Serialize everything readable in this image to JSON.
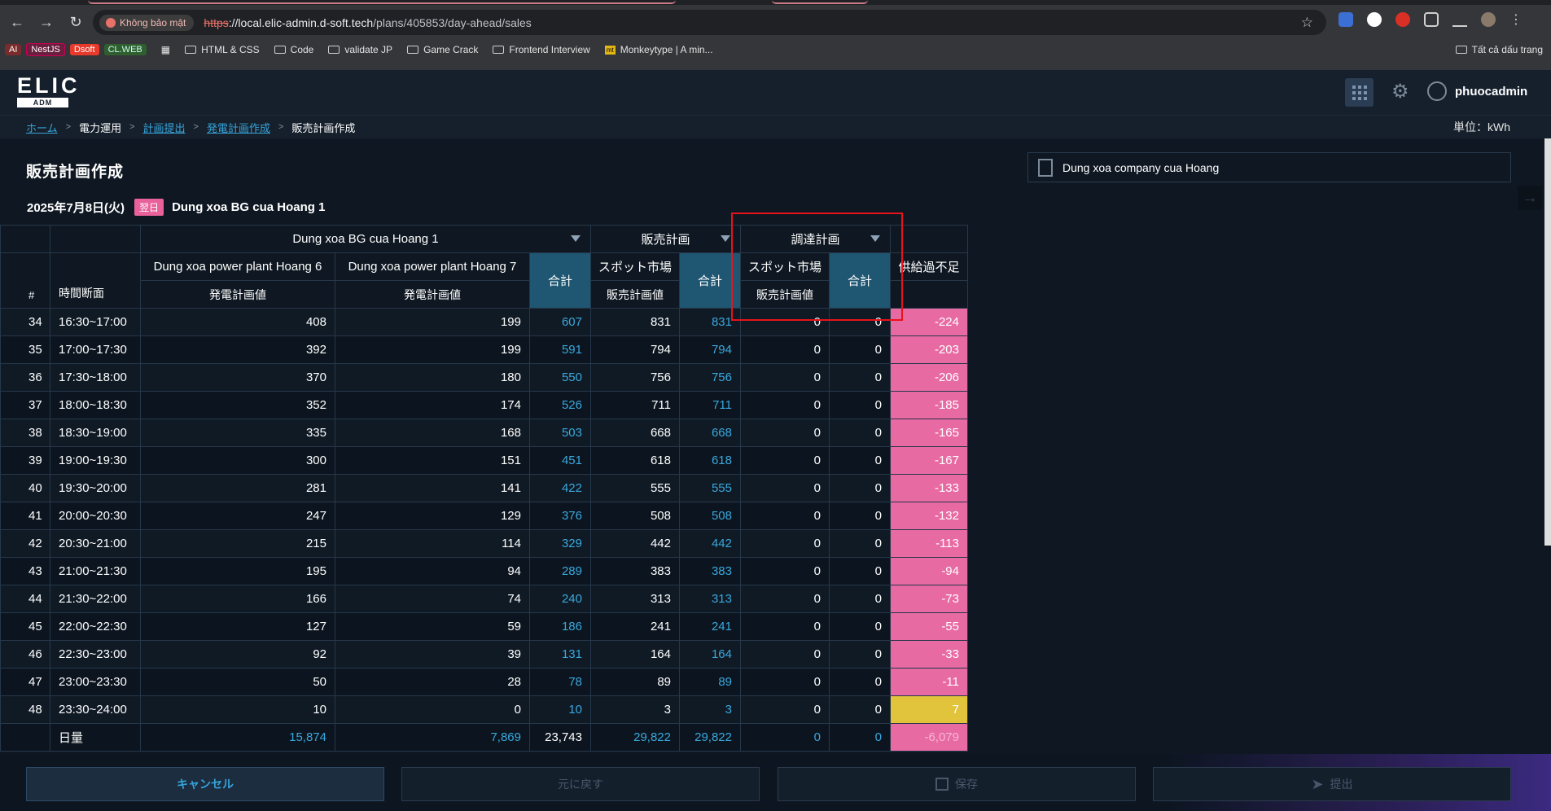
{
  "browser": {
    "insecure_label": "Không bảo mật",
    "url_scheme": "https",
    "url_host": "://local.elic-admin.d-soft.tech",
    "url_path": "/plans/405853/day-ahead/sales",
    "bookmarks": {
      "chips": [
        "AI",
        "NestJS",
        "Dsoft",
        "CL.WEB"
      ],
      "folders": [
        "HTML & CSS",
        "Code",
        "validate JP",
        "Game Crack",
        "Frontend Interview"
      ],
      "monkeytype": "Monkeytype | A min...",
      "all": "Tất cả dấu trang"
    }
  },
  "header": {
    "logo_main": "ELIC",
    "logo_sub": "ADM",
    "user_name": "phuocadmin"
  },
  "breadcrumb": {
    "items": [
      "ホーム",
      "電力運用",
      "計画提出",
      "発電計画作成",
      "販売計画作成"
    ],
    "unit": "単位：kWh"
  },
  "page": {
    "title": "販売計画作成",
    "company": "Dung xoa company cua Hoang",
    "date": "2025年7月8日(火)",
    "badge": "翌日",
    "bg_name": "Dung xoa BG cua Hoang 1"
  },
  "table": {
    "group_bg": "Dung xoa BG cua Hoang 1",
    "group_sales": "販売計画",
    "group_procure": "調達計画",
    "col_num": "#",
    "col_time": "時間断面",
    "col_plant6": "Dung xoa power plant Hoang 6",
    "col_plant7": "Dung xoa power plant Hoang 7",
    "col_gen_value": "発電計画値",
    "col_sum": "合計",
    "col_spot": "スポット市場",
    "col_sales_value": "販売計画値",
    "col_balance": "供給過不足",
    "rows": [
      [
        "34",
        "16:30~17:00",
        "408",
        "199",
        "607",
        "831",
        "831",
        "0",
        "0",
        "-224"
      ],
      [
        "35",
        "17:00~17:30",
        "392",
        "199",
        "591",
        "794",
        "794",
        "0",
        "0",
        "-203"
      ],
      [
        "36",
        "17:30~18:00",
        "370",
        "180",
        "550",
        "756",
        "756",
        "0",
        "0",
        "-206"
      ],
      [
        "37",
        "18:00~18:30",
        "352",
        "174",
        "526",
        "711",
        "711",
        "0",
        "0",
        "-185"
      ],
      [
        "38",
        "18:30~19:00",
        "335",
        "168",
        "503",
        "668",
        "668",
        "0",
        "0",
        "-165"
      ],
      [
        "39",
        "19:00~19:30",
        "300",
        "151",
        "451",
        "618",
        "618",
        "0",
        "0",
        "-167"
      ],
      [
        "40",
        "19:30~20:00",
        "281",
        "141",
        "422",
        "555",
        "555",
        "0",
        "0",
        "-133"
      ],
      [
        "41",
        "20:00~20:30",
        "247",
        "129",
        "376",
        "508",
        "508",
        "0",
        "0",
        "-132"
      ],
      [
        "42",
        "20:30~21:00",
        "215",
        "114",
        "329",
        "442",
        "442",
        "0",
        "0",
        "-113"
      ],
      [
        "43",
        "21:00~21:30",
        "195",
        "94",
        "289",
        "383",
        "383",
        "0",
        "0",
        "-94"
      ],
      [
        "44",
        "21:30~22:00",
        "166",
        "74",
        "240",
        "313",
        "313",
        "0",
        "0",
        "-73"
      ],
      [
        "45",
        "22:00~22:30",
        "127",
        "59",
        "186",
        "241",
        "241",
        "0",
        "0",
        "-55"
      ],
      [
        "46",
        "22:30~23:00",
        "92",
        "39",
        "131",
        "164",
        "164",
        "0",
        "0",
        "-33"
      ],
      [
        "47",
        "23:00~23:30",
        "50",
        "28",
        "78",
        "89",
        "89",
        "0",
        "0",
        "-11"
      ],
      [
        "48",
        "23:30~24:00",
        "10",
        "0",
        "10",
        "3",
        "3",
        "0",
        "0",
        "7"
      ]
    ],
    "total": [
      "",
      "日量",
      "15,874",
      "7,869",
      "23,743",
      "29,822",
      "29,822",
      "0",
      "0",
      "-6,079"
    ]
  },
  "footer": {
    "cancel": "キャンセル",
    "undo": "元に戻す",
    "save": "保存",
    "submit": "提出"
  }
}
